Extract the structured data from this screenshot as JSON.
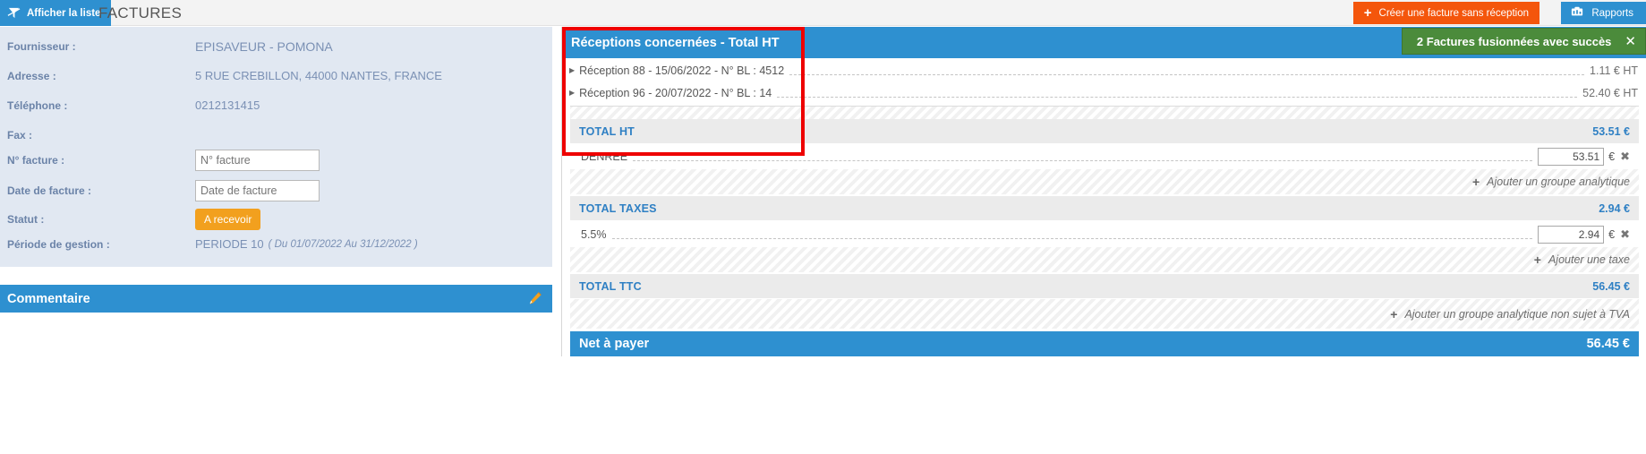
{
  "topbar": {
    "list_button_label": "Afficher la liste",
    "list_button_icon": "zigzag-filter-icon",
    "page_title": "FACTURES",
    "create_button_label": "Créer une facture sans réception",
    "create_button_icon": "plus-icon",
    "reports_button_label": "Rapports",
    "reports_button_icon": "report-chart-icon"
  },
  "supplier": {
    "fournisseur_label": "Fournisseur :",
    "fournisseur_value": "EPISAVEUR - POMONA",
    "adresse_label": "Adresse :",
    "adresse_value": "5 RUE CREBILLON, 44000 NANTES, FRANCE",
    "telephone_label": "Téléphone :",
    "telephone_value": "0212131415",
    "fax_label": "Fax :",
    "fax_value": "",
    "num_facture_label": "N° facture :",
    "num_facture_placeholder": "N° facture",
    "num_facture_value": "",
    "date_facture_label": "Date de facture :",
    "date_facture_placeholder": "Date de facture",
    "date_facture_value": "",
    "statut_label": "Statut :",
    "statut_value": "A recevoir",
    "periode_label": "Période de gestion :",
    "periode_value": "PERIODE 10",
    "periode_range": "( Du 01/07/2022 Au 31/12/2022 )"
  },
  "comment": {
    "title": "Commentaire",
    "edit_icon": "pencil-icon"
  },
  "receptions_panel": {
    "header_title": "Réceptions concernées - Total HT",
    "rows": [
      {
        "caret": "▶",
        "text": "Réception 88  -  15/06/2022  -  N° BL : 4512",
        "amount": "1.11 € HT"
      },
      {
        "caret": "▶",
        "text": "Réception 96  -  20/07/2022  -  N° BL : 14",
        "amount": "52.40 € HT"
      }
    ]
  },
  "toast": {
    "message": "2 Factures fusionnées avec succès",
    "close_icon": "close-icon",
    "color": "#4b8b3b"
  },
  "totals": {
    "total_ht_label": "TOTAL HT",
    "total_ht_amount": "53.51 €",
    "denree_label": "DENREE",
    "denree_value": "53.51",
    "denree_currency": "€",
    "add_analytic_group_label": "Ajouter un groupe analytique",
    "total_taxes_label": "TOTAL TAXES",
    "total_taxes_amount": "2.94 €",
    "tax_rate_label": "5.5%",
    "tax_value": "2.94",
    "tax_currency": "€",
    "add_tax_label": "Ajouter une taxe",
    "total_ttc_label": "TOTAL TTC",
    "total_ttc_amount": "56.45 €",
    "add_non_vat_group_label": "Ajouter un groupe analytique non sujet à TVA",
    "net_a_payer_label": "Net à payer",
    "net_a_payer_amount": "56.45 €"
  },
  "theme": {
    "blue": "#2e90d0",
    "orange": "#f4560c",
    "amber": "#f2a01e",
    "green": "#4b8b3b",
    "annotation_red": "#ee0000",
    "panel_bg": "#e1e8f2"
  }
}
